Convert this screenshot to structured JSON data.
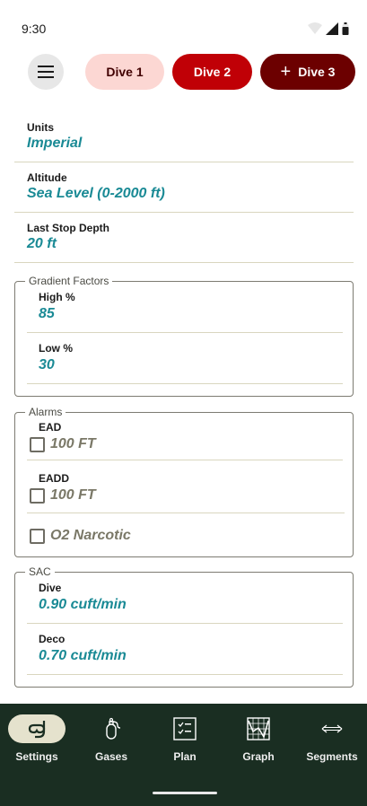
{
  "status_bar": {
    "time": "9:30"
  },
  "top_bar": {
    "dives": [
      {
        "label": "Dive 1"
      },
      {
        "label": "Dive 2"
      },
      {
        "label": "Dive 3",
        "prefix": "+"
      }
    ]
  },
  "settings": {
    "units": {
      "label": "Units",
      "value": "Imperial"
    },
    "altitude": {
      "label": "Altitude",
      "value": "Sea Level (0-2000 ft)"
    },
    "last_stop": {
      "label": "Last Stop Depth",
      "value": "20 ft"
    },
    "gradient_factors": {
      "title": "Gradient Factors",
      "high": {
        "label": "High %",
        "value": "85"
      },
      "low": {
        "label": "Low %",
        "value": "30"
      }
    },
    "alarms": {
      "title": "Alarms",
      "ead": {
        "label": "EAD",
        "value": "100 FT",
        "checked": false
      },
      "eadd": {
        "label": "EADD",
        "value": "100 FT",
        "checked": false
      },
      "o2": {
        "value": "O2 Narcotic",
        "checked": false
      }
    },
    "sac": {
      "title": "SAC",
      "dive": {
        "label": "Dive",
        "value": "0.90 cuft/min"
      },
      "deco": {
        "label": "Deco",
        "value": "0.70 cuft/min"
      }
    }
  },
  "bottom_nav": {
    "items": [
      {
        "label": "Settings",
        "icon": "snorkel-mask-icon",
        "active": true
      },
      {
        "label": "Gases",
        "icon": "gas-tank-icon",
        "active": false
      },
      {
        "label": "Plan",
        "icon": "checklist-icon",
        "active": false
      },
      {
        "label": "Graph",
        "icon": "graph-icon",
        "active": false
      },
      {
        "label": "Segments",
        "icon": "arrows-horizontal-icon",
        "active": false
      }
    ]
  },
  "colors": {
    "accent_value": "#1a8a95",
    "dive1_bg": "#fcd7d3",
    "dive2_bg": "#c00006",
    "dive3_bg": "#6c0000",
    "nav_bg": "#1a2e22"
  }
}
